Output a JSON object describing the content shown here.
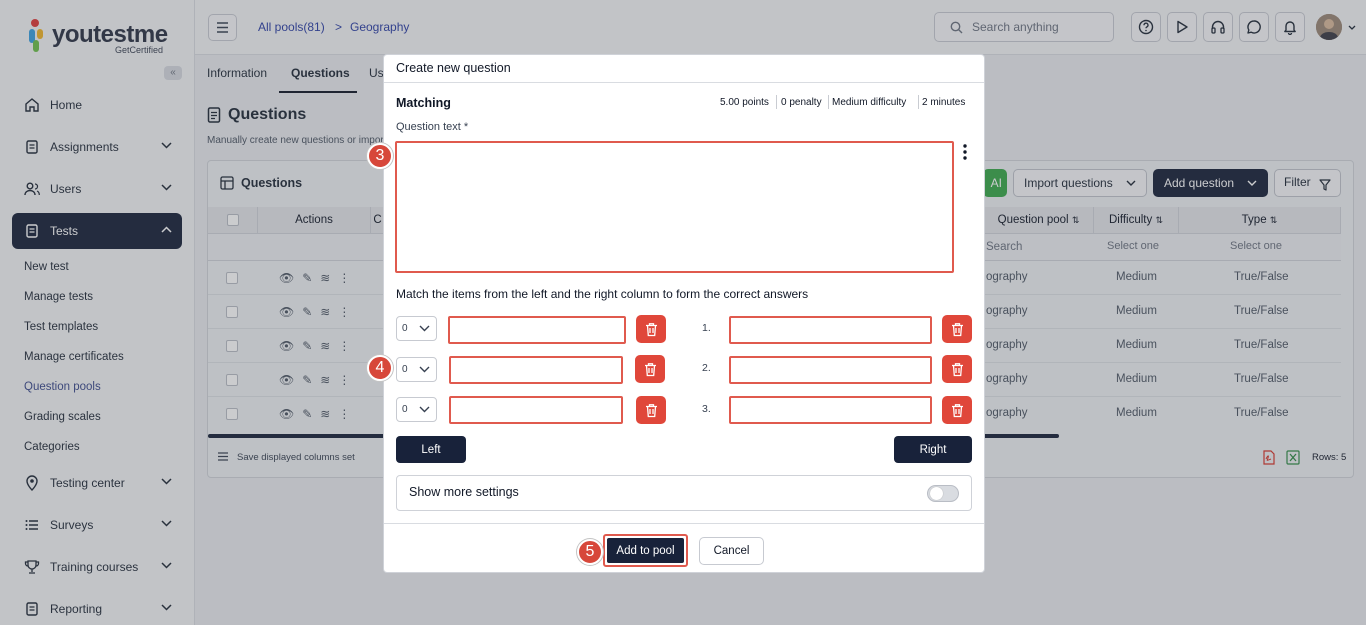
{
  "brand": {
    "name": "youtestme",
    "tagline": "GetCertified",
    "logo_colors": [
      "#e03a3a",
      "#3aa0e0",
      "#f0b429",
      "#6cc04a"
    ]
  },
  "sidebar": {
    "collapse_icon": "«",
    "items": [
      {
        "label": "Home"
      },
      {
        "label": "Assignments"
      },
      {
        "label": "Users"
      },
      {
        "label": "Tests"
      },
      {
        "label": "Testing center"
      },
      {
        "label": "Surveys"
      },
      {
        "label": "Training courses"
      },
      {
        "label": "Reporting"
      }
    ],
    "sub_items": [
      {
        "label": "New test"
      },
      {
        "label": "Manage tests"
      },
      {
        "label": "Test templates"
      },
      {
        "label": "Manage certificates"
      },
      {
        "label": "Question pools"
      },
      {
        "label": "Grading scales"
      },
      {
        "label": "Categories"
      }
    ]
  },
  "topbar": {
    "crumb_root": "All pools(81)",
    "crumb_sep": ">",
    "crumb_current": "Geography",
    "search_placeholder": "Search anything"
  },
  "page": {
    "tabs": [
      {
        "label": "Information"
      },
      {
        "label": "Questions"
      },
      {
        "label": "Us"
      }
    ],
    "title": "Questions",
    "description": "Manually create new questions or import t",
    "panel_title": "Questions",
    "ai_label": "AI",
    "import_label": "Import questions",
    "add_label": "Add question",
    "filter_label": "Filter",
    "columns": {
      "actions": "Actions",
      "c": "C",
      "pool": "Question pool",
      "difficulty": "Difficulty",
      "type": "Type"
    },
    "filters": {
      "pool": "Search",
      "difficulty": "Select one",
      "type": "Select one"
    },
    "rows": [
      {
        "pool": "ography",
        "difficulty": "Medium",
        "type": "True/False"
      },
      {
        "pool": "ography",
        "difficulty": "Medium",
        "type": "True/False"
      },
      {
        "pool": "ography",
        "difficulty": "Medium",
        "type": "True/False"
      },
      {
        "pool": "ography",
        "difficulty": "Medium",
        "type": "True/False"
      },
      {
        "pool": "ography",
        "difficulty": "Medium",
        "type": "True/False"
      }
    ],
    "save_columns": "Save displayed columns set",
    "rows_count": "Rows: 5"
  },
  "modal": {
    "title": "Create new question",
    "type": "Matching",
    "meta": {
      "points": "5.00 points",
      "penalty": "0 penalty",
      "difficulty": "Medium difficulty",
      "time": "2 minutes"
    },
    "question_label": "Question text *",
    "match_label": "Match the items from the left and the right column to form the correct answers",
    "pairs": [
      {
        "select": "0",
        "num": "1."
      },
      {
        "select": "0",
        "num": "2."
      },
      {
        "select": "0",
        "num": "3."
      }
    ],
    "left_label": "Left",
    "right_label": "Right",
    "more_settings": "Show more settings",
    "more_settings_on": false,
    "add_label": "Add to pool",
    "cancel_label": "Cancel"
  },
  "badges": {
    "b3": "3",
    "b4": "4",
    "b5": "5"
  },
  "colors": {
    "accent_dark": "#18223a",
    "highlight_red": "#e05a4e",
    "delete_red": "#e0473a",
    "link_blue": "#2c3fa5"
  }
}
